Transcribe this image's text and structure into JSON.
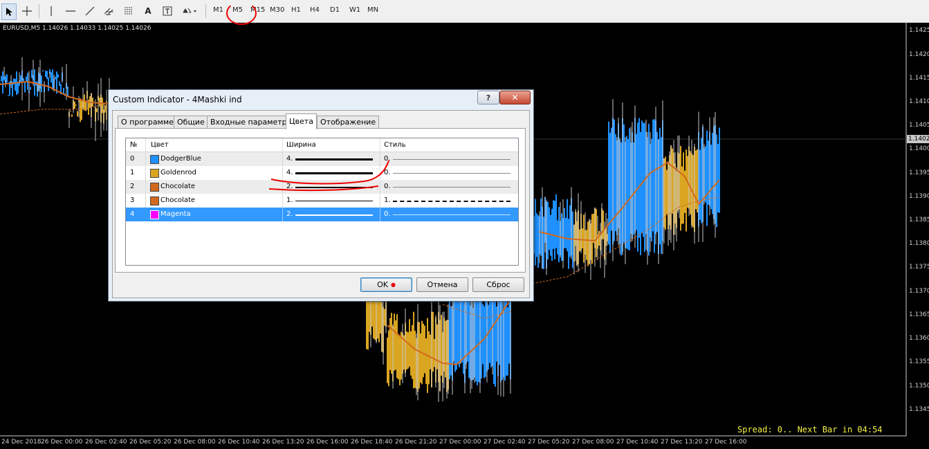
{
  "toolbar": {
    "timeframes": [
      "M1",
      "M5",
      "M15",
      "M30",
      "H1",
      "H4",
      "D1",
      "W1",
      "MN"
    ],
    "selected_timeframe": "M5",
    "text_tool_label": "A"
  },
  "chart": {
    "symbol_info": "EURUSD,M5  1.14026 1.14033 1.14025 1.14026",
    "price_labels": [
      "1.1425",
      "1.1420",
      "1.1415",
      "1.1410",
      "1.1405",
      "1.1400",
      "1.1395",
      "1.1390",
      "1.1385",
      "1.1380",
      "1.1375",
      "1.1370",
      "1.1365",
      "1.1360",
      "1.1355",
      "1.1350",
      "1.1345"
    ],
    "current_price": "1.14026",
    "time_labels": [
      "24 Dec 2018",
      "26 Dec 00:00",
      "26 Dec 02:40",
      "26 Dec 05:20",
      "26 Dec 08:00",
      "26 Dec 10:40",
      "26 Dec 13:20",
      "26 Dec 16:00",
      "26 Dec 18:40",
      "26 Dec 21:20",
      "27 Dec 00:00",
      "27 Dec 02:40",
      "27 Dec 05:20",
      "27 Dec 08:00",
      "27 Dec 10:40",
      "27 Dec 13:20",
      "27 Dec 16:00"
    ],
    "spread_text": "Spread: 0.. Next Bar in 04:54",
    "colors": {
      "up": "#1e90ff",
      "down": "#daa520",
      "ma": "#d2691e",
      "background": "#000000"
    }
  },
  "dialog": {
    "title": "Custom Indicator - 4Mashki ind",
    "help_label": "?",
    "close_label": "✕",
    "tabs": [
      "О программе",
      "Общие",
      "Входные параметры",
      "Цвета",
      "Отображение"
    ],
    "active_tab": "Цвета",
    "columns": [
      "№",
      "Цвет",
      "Ширина",
      "Стиль"
    ],
    "rows": [
      {
        "num": "0",
        "color_name": "DodgerBlue",
        "color_hex": "#1e90ff",
        "width": "4.",
        "style": "0."
      },
      {
        "num": "1",
        "color_name": "Goldenrod",
        "color_hex": "#daa520",
        "width": "4.",
        "style": "0."
      },
      {
        "num": "2",
        "color_name": "Chocolate",
        "color_hex": "#d2691e",
        "width": "2.",
        "style": "0."
      },
      {
        "num": "3",
        "color_name": "Chocolate",
        "color_hex": "#d2691e",
        "width": "1.",
        "style": "1."
      },
      {
        "num": "4",
        "color_name": "Magenta",
        "color_hex": "#ff00ff",
        "width": "2.",
        "style": "0."
      }
    ],
    "selected_row": "4",
    "buttons": {
      "ok": "OK",
      "cancel": "Отмена",
      "reset": "Сброс"
    }
  }
}
